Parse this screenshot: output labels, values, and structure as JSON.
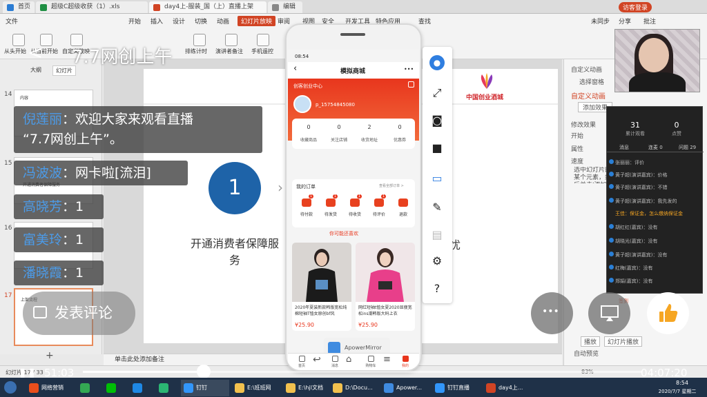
{
  "browser": {
    "tabs": [
      {
        "label": "首页"
      },
      {
        "label": "超级C超级收获（1）.xls"
      },
      {
        "label": "day4上-服装_国（上）直播上架"
      },
      {
        "label": "编辑"
      }
    ],
    "user_badge": "访客登录"
  },
  "ribbon": {
    "menus": [
      "文件",
      "开始",
      "插入",
      "设计",
      "切换",
      "动画",
      "幻灯片放映",
      "审阅",
      "视图",
      "安全",
      "开发工具",
      "特色应用",
      "查找"
    ],
    "active_menu": "幻灯片放映",
    "collab": [
      "未同步",
      "分享",
      "批注"
    ],
    "buttons": [
      "从头开始",
      "从当前开始",
      "自定义放映",
      "排练计时",
      "演讲者备注",
      "手机遥控"
    ]
  },
  "slide_panel": {
    "tabs": [
      "大纲",
      "幻灯片"
    ],
    "numbers": [
      "14",
      "15",
      "16",
      "17"
    ],
    "thumb14_title": "内容",
    "thumb15_text": "开通消费者保障服务",
    "thumb17_title": "上架流程",
    "add_symbol": "+"
  },
  "slide": {
    "circle_number": "1",
    "service_text": "开通消费者保障服务",
    "arrow": "›",
    "logo_text": "中国创业酒城",
    "partial_char": "忧",
    "notes_placeholder": "单击此处添加备注"
  },
  "status": {
    "slide_counter": "幻灯片 17 / 33",
    "zoom": "83%"
  },
  "task_pane": {
    "title": "自定义动画",
    "select_pane": "选择窗格",
    "section_title": "自定义动画",
    "add_effect": "添加效果",
    "modify": "修改效果",
    "start_label": "开始",
    "property_label": "属性",
    "speed_label": "速度",
    "hint": "选中幻灯片的某个元素，然后单击'添加效果'添加动画。",
    "play_label": "播放",
    "slideshow_label": "幻灯片播放",
    "autopreview": "自动预览"
  },
  "live_panel": {
    "count1": "31",
    "count1_label": "累计观看",
    "count2": "0",
    "count2_label": "点赞",
    "tabs": [
      "消息",
      "连麦 0",
      "问题 29"
    ],
    "rows": [
      "张丽丽：评价",
      "黄子超(演讲嘉宾)：价格",
      "黄子超(演讲嘉宾)：不错",
      "黄子超(演讲嘉宾)：我先发的",
      "王佳：保证金，怎么缴纳保证金",
      "胡红红(嘉宾)：没有",
      "胡晓光(嘉宾)：没有",
      "黄子超(演讲嘉宾)：没有",
      "红梅(嘉宾)：没有",
      "郑娟(嘉宾)：没有"
    ],
    "highlight_row": 4,
    "signin": "签到"
  },
  "phone": {
    "time": "08:54",
    "nav_title": "模拟商城",
    "more": "•••",
    "center_label": "创客创业中心",
    "username": "p_15754845080",
    "stats": [
      {
        "n": "0",
        "l": "收藏商品"
      },
      {
        "n": "0",
        "l": "关注店铺"
      },
      {
        "n": "2",
        "l": "收货地址"
      },
      {
        "n": "0",
        "l": "优惠券"
      }
    ],
    "orders_title": "我的订单",
    "orders_all": "查看全部订单 >",
    "orders": [
      "待付款",
      "待发货",
      "待收货",
      "待评价",
      "退款"
    ],
    "badges": [
      "1",
      "1",
      "1",
      "1"
    ],
    "recommend": "你可能还喜欢",
    "products": [
      {
        "title": "2020年夏装新款韩版宽松纯棉短袖T恤女原创bf风",
        "price": "¥25.90"
      },
      {
        "title": "网红短袖t恤女夏2020显瘦宽松ins潮韩版大码上衣",
        "price": "¥25.90"
      }
    ],
    "bottom_nav": [
      "首页",
      "消息",
      "购物车",
      "我的"
    ],
    "mirror_label": "ApowerMirror"
  },
  "overlay": {
    "back": "<",
    "title": "7.7网创上午",
    "chats": [
      {
        "name": "倪莲丽",
        "text": "：欢迎大家来观看直播",
        "text2": "“7.7网创上午”。"
      },
      {
        "name": "冯波波",
        "text": "：网卡啦[流泪]"
      },
      {
        "name": "高晓芳",
        "text": "：1"
      },
      {
        "name": "富美玲",
        "text": "：1"
      },
      {
        "name": "潘晓霞",
        "text": "：1"
      }
    ],
    "comment_label": "发表评论",
    "more_symbol": "•••",
    "like_color": "#f6a623"
  },
  "player": {
    "current_time": "51:03",
    "total_time": "04:07:20",
    "progress": 0.216
  },
  "taskbar": {
    "items": [
      "网络营销",
      "QQ",
      "爱奇艺",
      "K",
      "F",
      "钉钉",
      "E:\\班班网",
      "E:\\hjl文档",
      "D:\\Docu...",
      "Apower...",
      "钉钉直播",
      "day4上..."
    ],
    "time": "8:54",
    "date": "2020/7/7 星期二"
  },
  "colors": {
    "ribbon_highlight": "#d14424",
    "phone_red": "#e8361d",
    "chat_name": "#4c9be8",
    "taskbar": "#1f3148"
  }
}
